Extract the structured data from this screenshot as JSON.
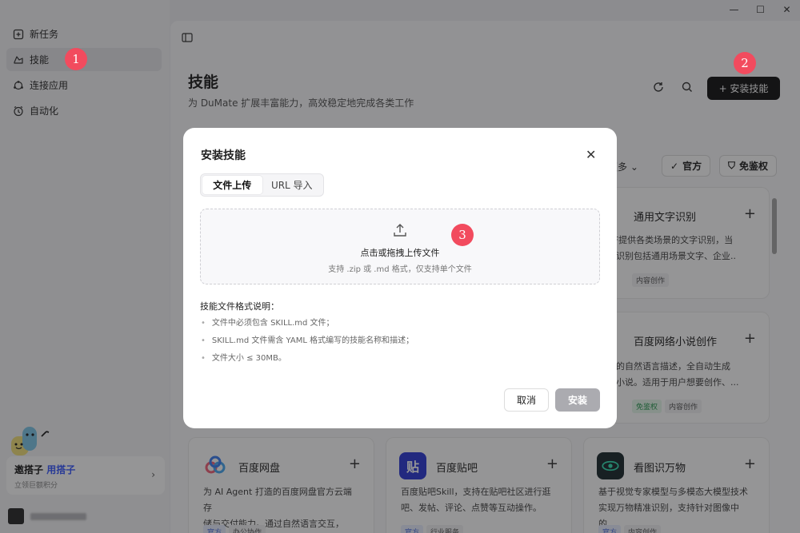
{
  "window": {
    "minimize": "—",
    "maximize": "☐",
    "close": "✕"
  },
  "sidebar": {
    "items": [
      {
        "label": "新任务",
        "icon": "new-task-icon"
      },
      {
        "label": "技能",
        "icon": "skill-icon",
        "active": true
      },
      {
        "label": "连接应用",
        "icon": "connect-app-icon"
      },
      {
        "label": "自动化",
        "icon": "automation-icon"
      }
    ],
    "promo": {
      "title_a": "邀搭子",
      "title_b": "用搭子",
      "subtitle": "立领巨额积分"
    }
  },
  "header": {
    "title": "技能",
    "subtitle": "为 DuMate 扩展丰富能力，高效稳定地完成各类工作",
    "install_label": "+ 安装技能"
  },
  "filters": {
    "more": "更多 ⌄",
    "official": "官方",
    "auth_free": "免鉴权"
  },
  "cards": [
    {
      "title": "通用文字识别",
      "desc1": "/PDF提供各类场景的文字识别，当",
      "desc2": "需要识别包括通用场景文字、企业..",
      "tags": [
        "内容创作"
      ]
    },
    {
      "title": "百度网络小说创作",
      "desc1": "用户的自然语言描述，全自动生成",
      "desc2": "网络小说。适用于用户想要创作、...",
      "tags": [
        "免鉴权",
        "内容创作"
      ]
    },
    {
      "title": "百度网盘",
      "desc1": "为 AI Agent 打造的百度网盘官方云端存",
      "desc2": "储与交付能力。通过自然语言交互，让...",
      "tags": [
        "官方",
        "办公协作"
      ]
    },
    {
      "title": "百度贴吧",
      "logo_text": "贴",
      "desc1": "百度贴吧Skill，支持在贴吧社区进行逛",
      "desc2": "吧、发帖、评论、点赞等互动操作。",
      "tags": [
        "官方",
        "行业服务"
      ]
    },
    {
      "title": "看图识万物",
      "desc1": "基于视觉专家模型与多模态大模型技术",
      "desc2": "实现万物精准识别，支持针对图像中的...",
      "tags": [
        "官方",
        "内容创作"
      ]
    }
  ],
  "modal": {
    "title": "安装技能",
    "close": "✕",
    "tabs": [
      "文件上传",
      "URL 导入"
    ],
    "drop_title": "点击或拖拽上传文件",
    "drop_sub": "支持 .zip 或 .md 格式，仅支持单个文件",
    "notes_title": "技能文件格式说明：",
    "notes": [
      "文件中必须包含 SKILL.md 文件；",
      "SKILL.md 文件需含 YAML 格式编写的技能名称和描述；",
      "文件大小 ≤ 30MB。"
    ],
    "cancel": "取消",
    "install": "安装"
  },
  "badges": [
    "1",
    "2",
    "3"
  ],
  "colors": {
    "accent": "#3b5bff",
    "badge": "#f24b5e",
    "primary_btn": "#141414"
  }
}
